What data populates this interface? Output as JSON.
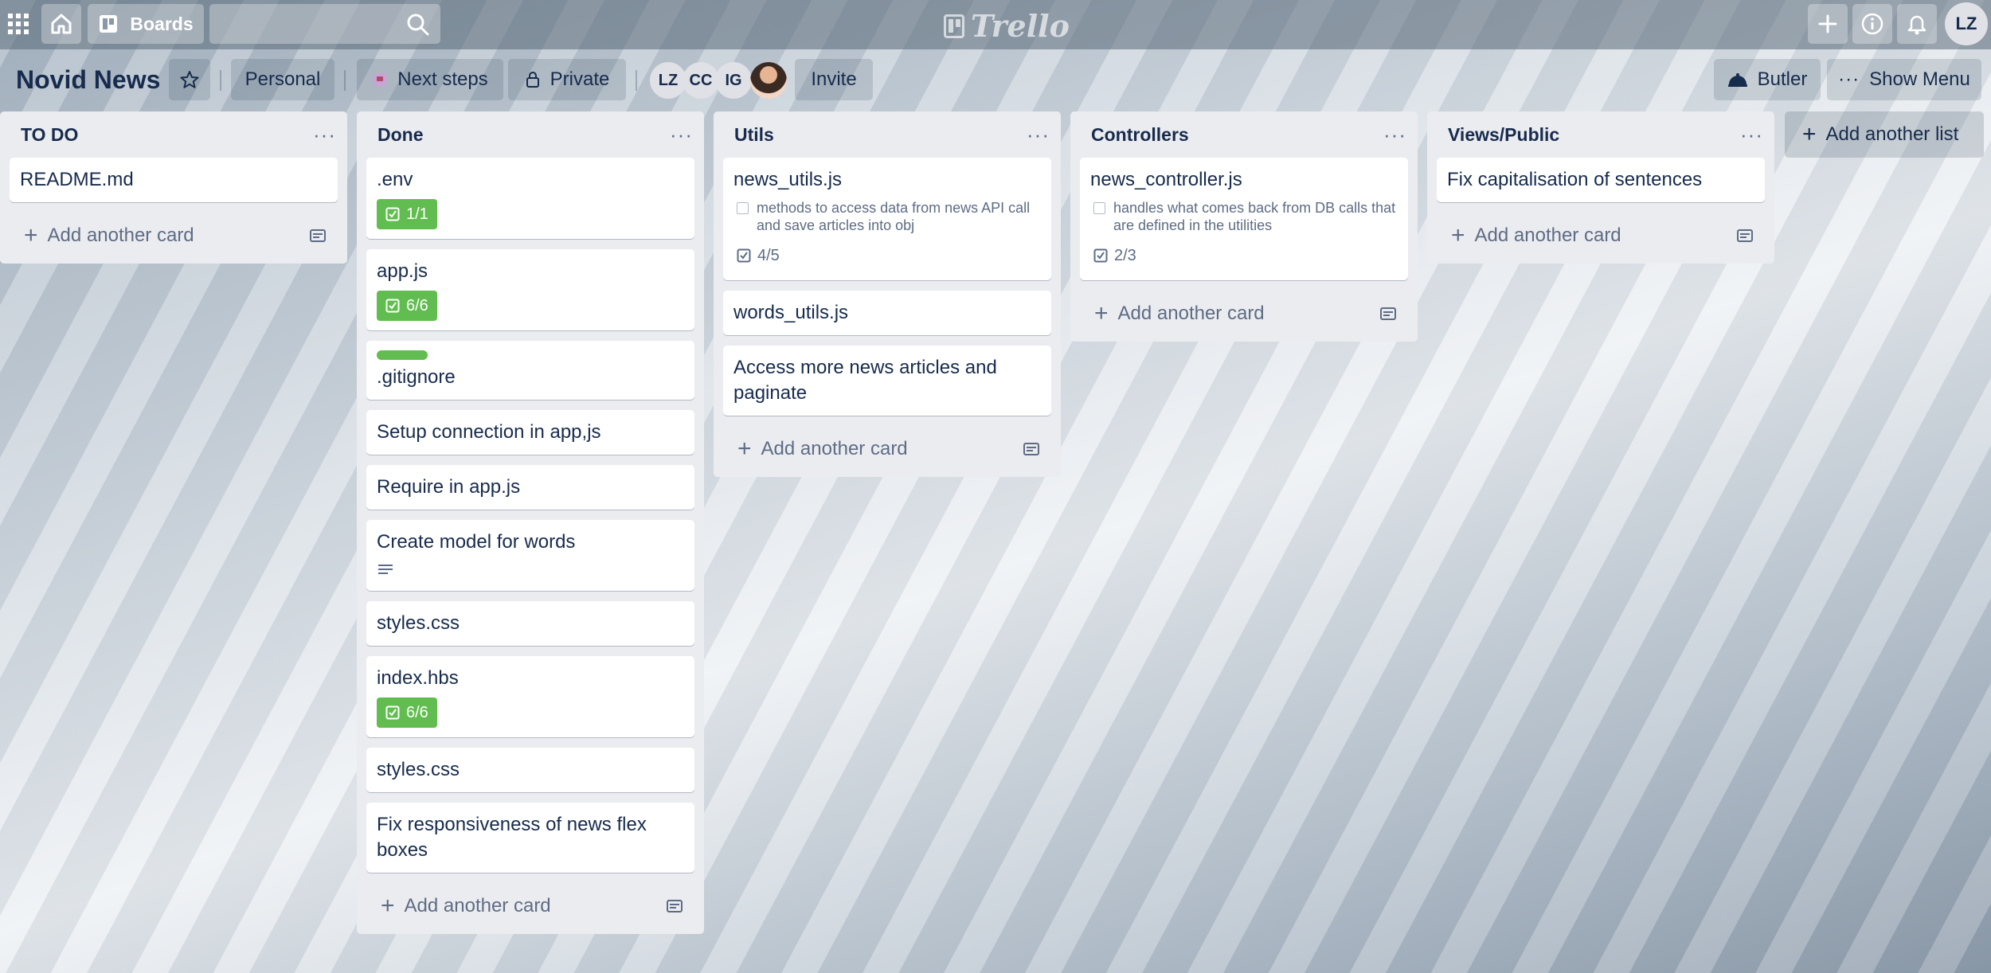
{
  "topbar": {
    "boards_label": "Boards",
    "search_placeholder": "",
    "logo_text": "Trello",
    "user_initials": "LZ"
  },
  "board": {
    "title": "Novid News",
    "team_label": "Personal",
    "powerup_label": "Next steps",
    "visibility_label": "Private",
    "members": [
      "LZ",
      "CC",
      "IG"
    ],
    "invite_label": "Invite",
    "butler_label": "Butler",
    "show_menu_label": "Show Menu"
  },
  "lists": [
    {
      "title": "TO DO",
      "menu": "···",
      "cards": [
        {
          "title": "README.md"
        }
      ],
      "add_card": "Add another card"
    },
    {
      "title": "Done",
      "menu": "···",
      "cards": [
        {
          "title": ".env",
          "checklist": "1/1"
        },
        {
          "title": "app.js",
          "checklist": "6/6"
        },
        {
          "title": ".gitignore",
          "label_color": "#61bd4f"
        },
        {
          "title": "Setup connection in app,js"
        },
        {
          "title": "Require in app.js"
        },
        {
          "title": "Create model for words",
          "has_description": true
        },
        {
          "title": "styles.css"
        },
        {
          "title": "index.hbs",
          "checklist": "6/6"
        },
        {
          "title": "styles.css"
        },
        {
          "title": "Fix responsiveness of news flex boxes"
        }
      ],
      "add_card": "Add another card"
    },
    {
      "title": "Utils",
      "menu": "···",
      "cards": [
        {
          "title": "news_utils.js",
          "check_text": "methods to access data from news API call and save articles into obj",
          "checklist": "4/5"
        },
        {
          "title": "words_utils.js"
        },
        {
          "title": "Access more news articles and paginate"
        }
      ],
      "add_card": "Add another card"
    },
    {
      "title": "Controllers",
      "menu": "···",
      "cards": [
        {
          "title": "news_controller.js",
          "check_text": "handles what comes back from DB calls that are defined in the utilities",
          "checklist": "2/3"
        }
      ],
      "add_card": "Add another card"
    },
    {
      "title": "Views/Public",
      "menu": "···",
      "cards": [
        {
          "title": "Fix capitalisation of sentences"
        }
      ],
      "add_card": "Add another card"
    }
  ],
  "add_list_label": "Add another list",
  "colors": {
    "list_bg": "#ebecf0",
    "complete_green": "#61bd4f",
    "text": "#172b4d",
    "muted": "#5e6c84"
  }
}
